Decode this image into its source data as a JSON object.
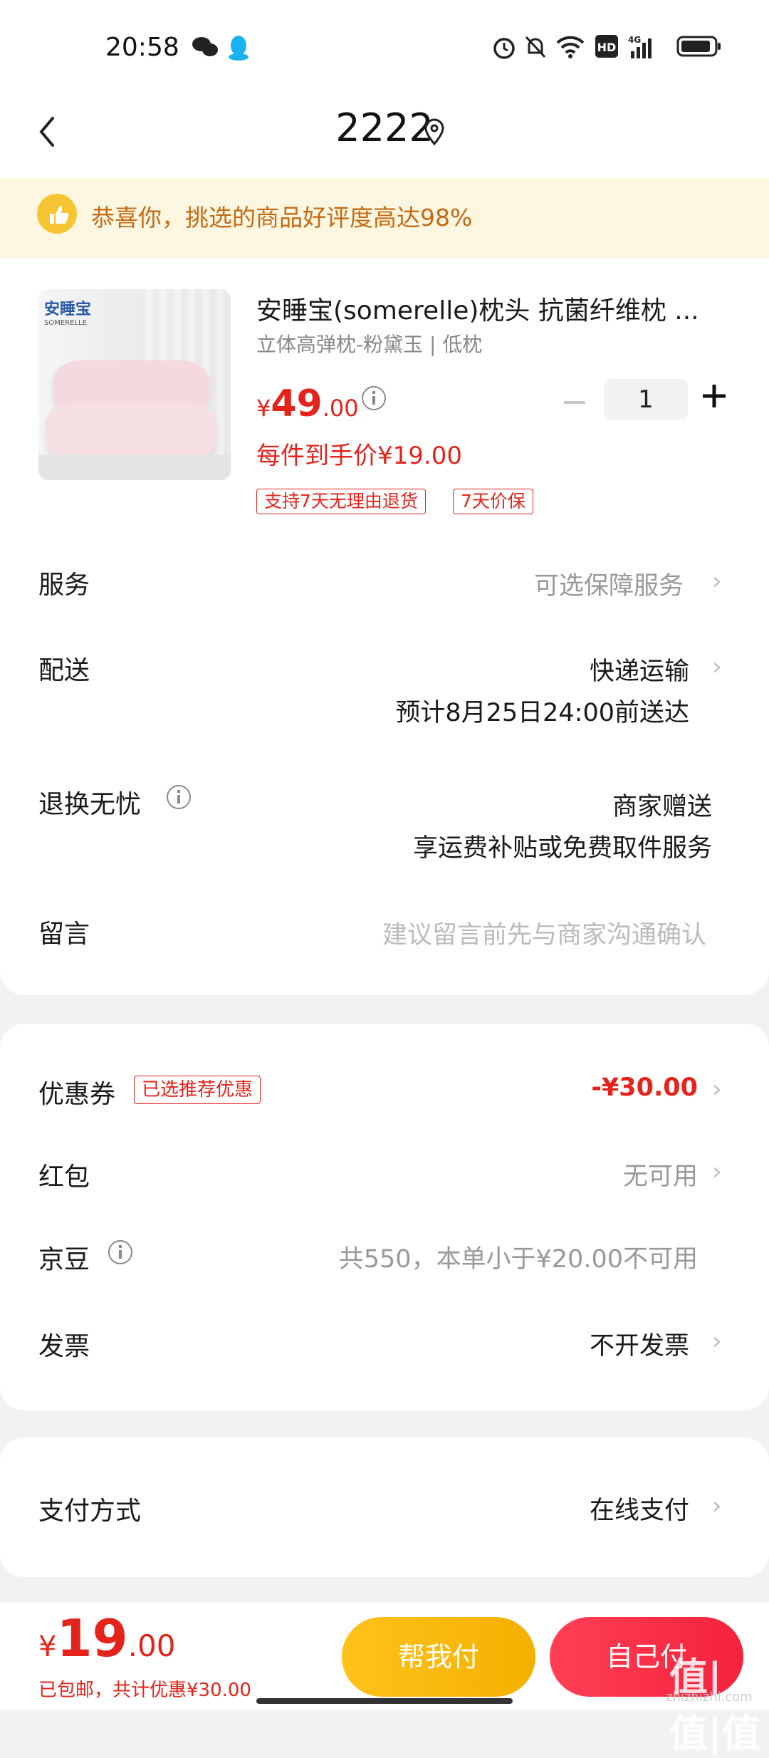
{
  "status_bar": {
    "time": "20:58"
  },
  "header": {
    "title": "2222"
  },
  "banner": {
    "text": "恭喜你，挑选的商品好评度高达98%"
  },
  "product": {
    "brand_logo_text": "安睡宝",
    "brand_logo_sub": "SOMERELLE",
    "name": "安睡宝(somerelle)枕头 抗菌纤维枕 ...",
    "spec": "立体高弹枕-粉黛玉 | 低枕",
    "price_yen": "¥",
    "price_int": "49",
    "price_dec": ".00",
    "quantity": "1",
    "hand_price": "每件到手价¥19.00",
    "tags": [
      "支持7天无理由退货",
      "7天价保"
    ]
  },
  "rows": {
    "service": {
      "label": "服务",
      "value": "可选保障服务"
    },
    "delivery": {
      "label": "配送",
      "value": "快递运输",
      "sub": "预计8月25日24:00前送达"
    },
    "return": {
      "label": "退换无忧",
      "value": "商家赠送",
      "sub": "享运费补贴或免费取件服务"
    },
    "message": {
      "label": "留言",
      "placeholder": "建议留言前先与商家沟通确认"
    }
  },
  "discounts": {
    "coupon": {
      "label": "优惠券",
      "tag": "已选推荐优惠",
      "value": "-¥30.00"
    },
    "redpacket": {
      "label": "红包",
      "value": "无可用"
    },
    "jingdou": {
      "label": "京豆",
      "value": "共550，本单小于¥20.00不可用"
    },
    "invoice": {
      "label": "发票",
      "value": "不开发票"
    }
  },
  "payment": {
    "label": "支付方式",
    "value": "在线支付"
  },
  "bottom": {
    "total_yen": "¥",
    "total_int": "19",
    "total_dec": ".00",
    "sub": "已包邮，共计优惠¥30.00",
    "btn_help": "帮我付",
    "btn_self": "自己付",
    "watermark": "值|值|值",
    "watermark_sub": "zhizhizhi.com"
  },
  "colors": {
    "accent": "#e4231b",
    "banner_bg": "#fdf6e0",
    "help_button": "#ffc21a",
    "self_button": "#f5223c"
  }
}
